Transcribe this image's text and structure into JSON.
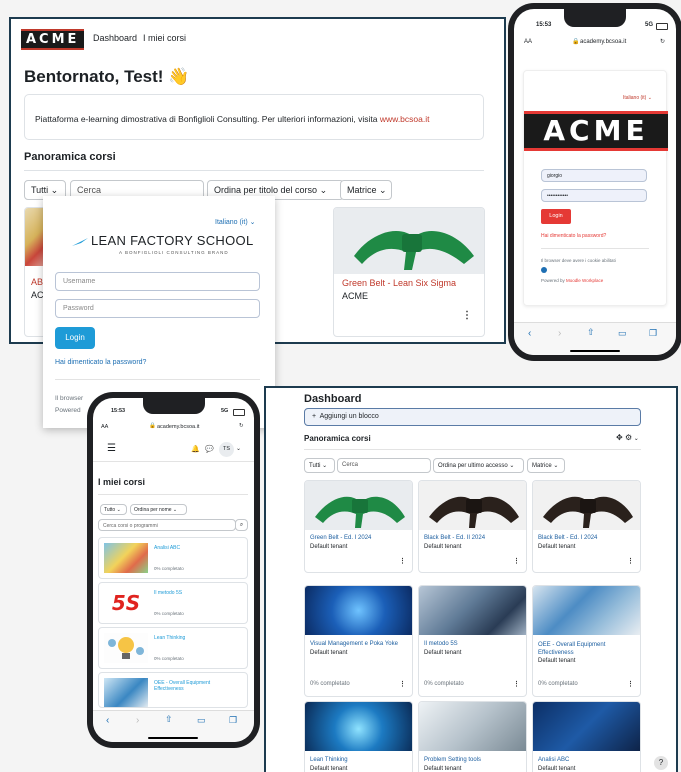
{
  "desktop_top": {
    "logo": "ACME",
    "nav": [
      "Dashboard",
      "I miei corsi"
    ],
    "welcome": "Bentornato, Test! 👋",
    "info_text": "Piattaforma e-learning dimostrativa di Bonfiglioli Consulting. Per ulteriori informazioni, visita ",
    "info_link": "www.bcsoa.it",
    "section_title": "Panoramica corsi",
    "filter_all": "Tutti",
    "search_placeholder": "Cerca",
    "sort": "Ordina per titolo del corso",
    "view": "Matrice",
    "cards": [
      {
        "title": "ABC",
        "subtitle": "ACM"
      },
      {
        "title": "Green Belt - Lean Six Sigma",
        "subtitle": "ACME"
      }
    ]
  },
  "login_lfs": {
    "language": "Italiano (it)",
    "brand": "LEAN FACTORY SCHOOL",
    "brand_sub": "A BONFIGLIOLI CONSULTING BRAND",
    "username_placeholder": "Username",
    "password_placeholder": "Password",
    "login_label": "Login",
    "forgot": "Hai dimenticato la password?",
    "cookie_text": "Il browser",
    "powered": "Powered"
  },
  "phone_right": {
    "time": "15:53",
    "signal": "5G",
    "url": "academy.bcsoa.it",
    "aa": "AA",
    "language": "Italiano (it)",
    "logo": "ACME",
    "username_value": "giorgio",
    "password_value": "••••••••••••",
    "login_label": "Login",
    "forgot": "Hai dimenticato la password?",
    "cookie_text": "Il browser deve avere i cookie abilitati",
    "powered_prefix": "Powered by ",
    "powered_link": "Moodle Workplace"
  },
  "phone_left": {
    "time": "15:53",
    "signal": "5G",
    "url": "academy.bcsoa.it",
    "aa": "AA",
    "avatar": "TS",
    "title": "I miei corsi",
    "filter": "Tutto",
    "sort": "Ordina per nome",
    "search_placeholder": "Cerca corsi o programmi",
    "courses": [
      {
        "name": "Analisi ABC",
        "progress": "0% completato"
      },
      {
        "name": "Il metodo 5S",
        "progress": "0% completato"
      },
      {
        "name": "Lean Thinking",
        "progress": "0% completato"
      },
      {
        "name": "OEE - Overall Equipment Effectiveness",
        "progress": "0% completato"
      }
    ]
  },
  "dashboard": {
    "title": "Dashboard",
    "add_block": "Aggiungi un blocco",
    "section_title": "Panoramica corsi",
    "filter_all": "Tutti",
    "search_placeholder": "Cerca",
    "sort": "Ordina per ultimo accesso",
    "view": "Matrice",
    "help": "?",
    "cards": [
      {
        "title": "Green Belt - Ed. I 2024",
        "tenant": "Default tenant",
        "progress": ""
      },
      {
        "title": "Black Belt - Ed. II 2024",
        "tenant": "Default tenant",
        "progress": ""
      },
      {
        "title": "Black Belt - Ed. I 2024",
        "tenant": "Default tenant",
        "progress": ""
      },
      {
        "title": "Visual Management e Poka Yoke",
        "tenant": "Default tenant",
        "progress": "0% completato"
      },
      {
        "title": "Il metodo 5S",
        "tenant": "Default tenant",
        "progress": "0% completato"
      },
      {
        "title": "OEE - Overall Equipment Effectiveness",
        "tenant": "Default tenant",
        "progress": "0% completato"
      },
      {
        "title": "Lean Thinking",
        "tenant": "Default tenant",
        "progress": ""
      },
      {
        "title": "Problem Setting tools",
        "tenant": "Default tenant",
        "progress": ""
      },
      {
        "title": "Analisi ABC",
        "tenant": "Default tenant",
        "progress": ""
      }
    ]
  },
  "colors": {
    "accent_red": "#e53935",
    "link_red": "#c0392b",
    "login_blue": "#1e9bd7",
    "border_navy": "#1d3b4f",
    "belt_green": "#1f8a45",
    "belt_black": "#2a211c"
  }
}
